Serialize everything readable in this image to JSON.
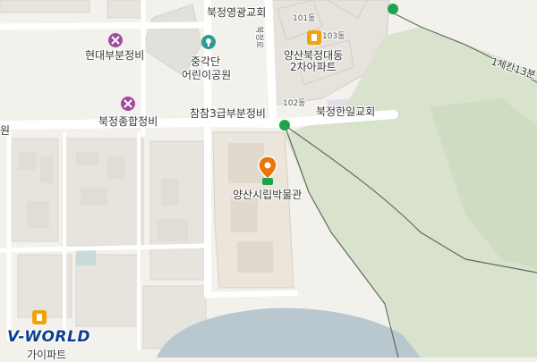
{
  "labels": {
    "church_top": "북정영광교회",
    "bldg_101": "101동",
    "bldg_103": "103동",
    "road_vertical": "북정로",
    "apartment_line1": "양산북정대동",
    "apartment_line2": "2차아파트",
    "bldg_102": "102동",
    "church_right": "북정한일교회",
    "park_line1": "중각단",
    "park_line2": "어린이공원",
    "repair_1": "현대부분정비",
    "repair_2": "북정종합정비",
    "repair_3": "참참3급부분정비",
    "museum": "양산시립박물관",
    "trail": "1체칸13분",
    "left_edge": "원",
    "bottom_left_partial": "가이파트"
  },
  "logo": {
    "text": "V-WORLD"
  },
  "colors": {
    "background": "#f3f1ec",
    "forest": "#d8e2cc",
    "water": "#b9c7cf",
    "museum_grounds": "#ebe5dc",
    "road": "#ffffff",
    "poi_purple": "#a24ba3",
    "poi_teal": "#2a9d8f",
    "poi_orange": "#f0a30a",
    "pin_orange": "#e8760a",
    "bus_green": "#1ea54c"
  }
}
